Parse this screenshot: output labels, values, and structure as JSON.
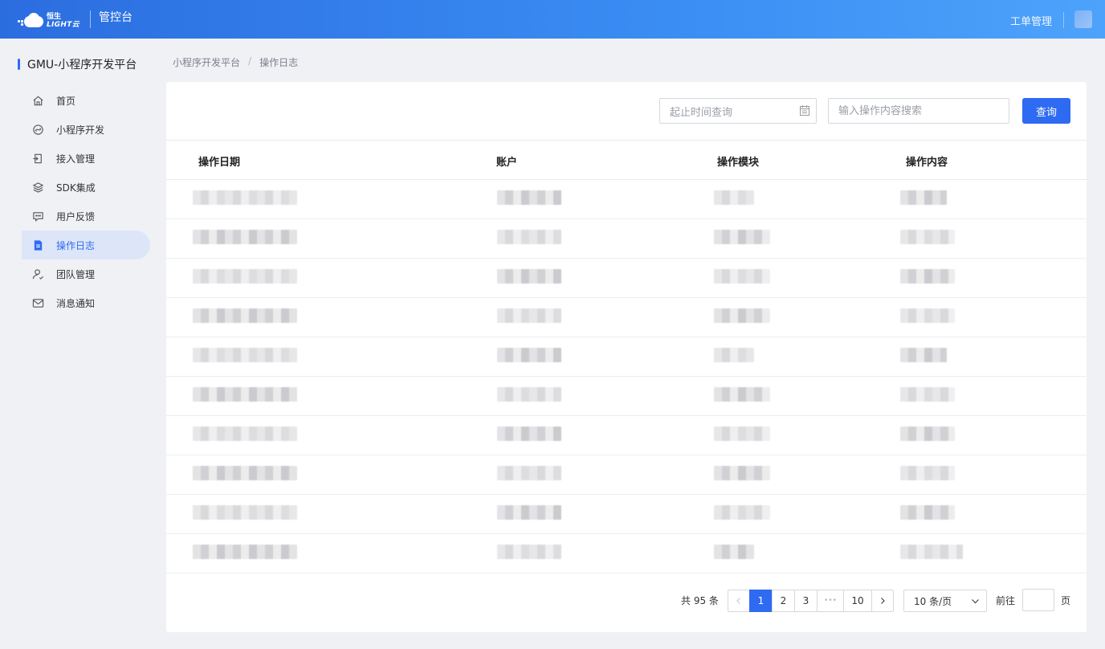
{
  "topbar": {
    "logo_cn": "恒生",
    "logo_en": "LIGHT云",
    "console": "管控台",
    "work_order": "工单管理"
  },
  "sidebar": {
    "title": "GMU-小程序开发平台",
    "items": [
      {
        "label": "首页",
        "icon": "home-icon",
        "active": false
      },
      {
        "label": "小程序开发",
        "icon": "miniapp-icon",
        "active": false
      },
      {
        "label": "接入管理",
        "icon": "access-icon",
        "active": false
      },
      {
        "label": "SDK集成",
        "icon": "layers-icon",
        "active": false
      },
      {
        "label": "用户反馈",
        "icon": "chat-icon",
        "active": false
      },
      {
        "label": "操作日志",
        "icon": "document-icon",
        "active": true
      },
      {
        "label": "团队管理",
        "icon": "team-icon",
        "active": false
      },
      {
        "label": "消息通知",
        "icon": "mail-icon",
        "active": false
      }
    ]
  },
  "breadcrumb": {
    "parent": "小程序开发平台",
    "separator": "/",
    "current": "操作日志"
  },
  "filter": {
    "date_placeholder": "起止时间查询",
    "search_placeholder": "输入操作内容搜索",
    "query_label": "查询"
  },
  "table": {
    "columns": [
      "操作日期",
      "账户",
      "操作模块",
      "操作内容"
    ],
    "row_count_visible": 10,
    "cells_obscured": true
  },
  "pagination": {
    "total_text": "共 95 条",
    "pages": [
      "1",
      "2",
      "3",
      "•••",
      "10"
    ],
    "current_page": "1",
    "page_size": "10 条/页",
    "goto_label": "前往",
    "goto_value": "",
    "page_suffix": "页"
  },
  "colors": {
    "accent": "#2f6bf2",
    "topbar_start": "#2b6de0",
    "topbar_end": "#4da3fb",
    "active_item_bg": "#dde6f8"
  }
}
